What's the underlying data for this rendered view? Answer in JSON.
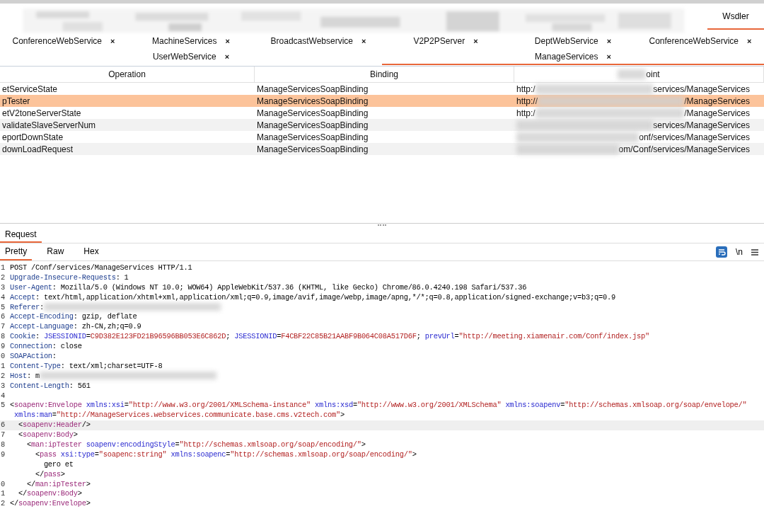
{
  "top_tabs": [
    {
      "label": "Wsdler",
      "selected": true
    }
  ],
  "service_tabs": [
    [
      {
        "label": "ConferenceWebService",
        "selected": false
      },
      {
        "label": "MachineServices",
        "selected": false
      },
      {
        "label": "BroadcastWebservice",
        "selected": false
      },
      {
        "label": "V2P2PServer",
        "selected": false
      },
      {
        "label": "DeptWebService",
        "selected": false
      },
      {
        "label": "ConferenceWebService",
        "selected": false
      }
    ],
    [
      {
        "label": "UserWebService",
        "selected": false
      },
      {
        "label": "ManageServices",
        "selected": true
      }
    ]
  ],
  "close_glyph": "×",
  "table": {
    "columns": [
      "Operation",
      "Binding",
      "oint"
    ],
    "rows": [
      {
        "operation": "etServiceState",
        "binding": "ManageServicesSoapBinding",
        "endpoint_start": "http:/",
        "endpoint_end": "services/ManageServices",
        "selected": false
      },
      {
        "operation": "pTester",
        "binding": "ManageServicesSoapBinding",
        "endpoint_start": "http://",
        "endpoint_end": "/ManageServices",
        "selected": true
      },
      {
        "operation": "etV2toneServerState",
        "binding": "ManageServicesSoapBinding",
        "endpoint_start": "http:/",
        "endpoint_end": "/ManageServices",
        "selected": false
      },
      {
        "operation": "validateSlaveServerNum",
        "binding": "ManageServicesSoapBinding",
        "endpoint_end": "services/ManageServices",
        "selected": false
      },
      {
        "operation": "eportDownState",
        "binding": "ManageServicesSoapBinding",
        "endpoint_end": "onf/services/ManageServices",
        "selected": false
      },
      {
        "operation": "downLoadRequest",
        "binding": "ManageServicesSoapBinding",
        "endpoint_end": "om/Conf/services/ManageServices",
        "selected": false
      }
    ]
  },
  "request_tab": {
    "label": "Request",
    "selected": true
  },
  "view_tabs": [
    {
      "label": "Pretty",
      "selected": true
    },
    {
      "label": "Raw",
      "selected": false
    },
    {
      "label": "Hex",
      "selected": false
    }
  ],
  "newline_toggle": "\\n",
  "lines": [
    {
      "no": "1",
      "segs": [
        {
          "kind": "plain",
          "text": "POST /Conf/services/ManageServices HTTP/1.1"
        }
      ]
    },
    {
      "no": "2",
      "segs": [
        {
          "kind": "key",
          "text": "Upgrade-Insecure-Requests"
        },
        {
          "kind": "plain",
          "text": ": 1"
        }
      ]
    },
    {
      "no": "3",
      "segs": [
        {
          "kind": "key",
          "text": "User-Agent"
        },
        {
          "kind": "plain",
          "text": ": Mozilla/5.0 (Windows NT 10.0; WOW64) AppleWebKit/537.36 (KHTML, like Gecko) Chrome/86.0.4240.198 Safari/537.36"
        }
      ]
    },
    {
      "no": "4",
      "segs": [
        {
          "kind": "key",
          "text": "Accept"
        },
        {
          "kind": "plain",
          "text": ": text/html,application/xhtml+xml,application/xml;q=0.9,image/avif,image/webp,image/apng,*/*;q=0.8,application/signed-exchange;v=b3;q=0.9"
        }
      ]
    },
    {
      "no": "5",
      "redacted": true,
      "segs": [
        {
          "kind": "key",
          "text": "Referer"
        },
        {
          "kind": "plain",
          "text": ":"
        }
      ]
    },
    {
      "no": "6",
      "segs": [
        {
          "kind": "key",
          "text": "Accept-Encoding"
        },
        {
          "kind": "plain",
          "text": ": gzip, deflate"
        }
      ]
    },
    {
      "no": "7",
      "segs": [
        {
          "kind": "key",
          "text": "Accept-Language"
        },
        {
          "kind": "plain",
          "text": ": zh-CN,zh;q=0.9"
        }
      ]
    },
    {
      "no": "8",
      "segs": [
        {
          "kind": "key",
          "text": "Cookie"
        },
        {
          "kind": "plain",
          "text": ": "
        },
        {
          "kind": "name",
          "text": "JSESSIONID"
        },
        {
          "kind": "plain",
          "text": "="
        },
        {
          "kind": "val",
          "text": "C9D382E123FD21B96596BB053E6C862D"
        },
        {
          "kind": "plain",
          "text": "; "
        },
        {
          "kind": "name",
          "text": "JSESSIONID"
        },
        {
          "kind": "plain",
          "text": "="
        },
        {
          "kind": "val",
          "text": "F4CBF22C85B21AABF9B064C08A517D6F"
        },
        {
          "kind": "plain",
          "text": "; "
        },
        {
          "kind": "name",
          "text": "prevUrl"
        },
        {
          "kind": "plain",
          "text": "="
        },
        {
          "kind": "val",
          "text": "\"http://meeting.xiamenair.com/Conf/index.jsp\""
        }
      ]
    },
    {
      "no": "9",
      "segs": [
        {
          "kind": "key",
          "text": "Connection"
        },
        {
          "kind": "plain",
          "text": ": close"
        }
      ]
    },
    {
      "no": "0",
      "segs": [
        {
          "kind": "key",
          "text": "SOAPAction"
        },
        {
          "kind": "plain",
          "text": ":"
        }
      ]
    },
    {
      "no": "1",
      "segs": [
        {
          "kind": "key",
          "text": "Content-Type"
        },
        {
          "kind": "plain",
          "text": ": text/xml;charset=UTF-8"
        }
      ]
    },
    {
      "no": "2",
      "redacted": true,
      "segs": [
        {
          "kind": "key",
          "text": "Host"
        },
        {
          "kind": "plain",
          "text": ": m"
        }
      ]
    },
    {
      "no": "3",
      "segs": [
        {
          "kind": "key",
          "text": "Content-Length"
        },
        {
          "kind": "plain",
          "text": ": 561"
        }
      ]
    },
    {
      "no": "4"
    },
    {
      "no": "5",
      "segs": [
        {
          "kind": "plain",
          "text": "<"
        },
        {
          "kind": "tag",
          "text": "soapenv:Envelope"
        },
        {
          "kind": "name",
          "text": " xmlns:xsi"
        },
        {
          "kind": "plain",
          "text": "="
        },
        {
          "kind": "val",
          "text": "\"http://www.w3.org/2001/XMLSchema-instance\""
        },
        {
          "kind": "name",
          "text": " xmlns:xsd"
        },
        {
          "kind": "plain",
          "text": "="
        },
        {
          "kind": "val",
          "text": "\"http://www.w3.org/2001/XMLSchema\""
        },
        {
          "kind": "name",
          "text": " xmlns:soapenv"
        },
        {
          "kind": "plain",
          "text": "="
        },
        {
          "kind": "val",
          "text": "\"http://schemas.xmlsoap.org/soap/envelope/\""
        }
      ]
    },
    {
      "segs": [
        {
          "kind": "name",
          "text": " xmlns:man"
        },
        {
          "kind": "plain",
          "text": "="
        },
        {
          "kind": "val",
          "text": "\"http://ManageServices.webservices.communicate.base.cms.v2tech.com\""
        },
        {
          "kind": "plain",
          "text": ">"
        }
      ]
    },
    {
      "no": "6",
      "highlighted": true,
      "segs": [
        {
          "kind": "plain",
          "text": "  <"
        },
        {
          "kind": "tag",
          "text": "soapenv:Header"
        },
        {
          "kind": "plain",
          "text": "/>"
        }
      ]
    },
    {
      "no": "7",
      "segs": [
        {
          "kind": "plain",
          "text": "  <"
        },
        {
          "kind": "tag",
          "text": "soapenv:Body"
        },
        {
          "kind": "plain",
          "text": ">"
        }
      ]
    },
    {
      "no": "8",
      "segs": [
        {
          "kind": "plain",
          "text": "    <"
        },
        {
          "kind": "tag",
          "text": "man:ipTester"
        },
        {
          "kind": "name",
          "text": " soapenv:encodingStyle"
        },
        {
          "kind": "plain",
          "text": "="
        },
        {
          "kind": "val",
          "text": "\"http://schemas.xmlsoap.org/soap/encoding/\""
        },
        {
          "kind": "plain",
          "text": ">"
        }
      ]
    },
    {
      "no": "9",
      "segs": [
        {
          "kind": "plain",
          "text": "      <"
        },
        {
          "kind": "tag",
          "text": "pass"
        },
        {
          "kind": "name",
          "text": " xsi:type"
        },
        {
          "kind": "plain",
          "text": "="
        },
        {
          "kind": "val",
          "text": "\"soapenc:string\""
        },
        {
          "kind": "name",
          "text": " xmlns:soapenc"
        },
        {
          "kind": "plain",
          "text": "="
        },
        {
          "kind": "val",
          "text": "\"http://schemas.xmlsoap.org/soap/encoding/\""
        },
        {
          "kind": "plain",
          "text": ">"
        }
      ]
    },
    {
      "segs": [
        {
          "kind": "plain",
          "text": "        gero et"
        }
      ]
    },
    {
      "segs": [
        {
          "kind": "plain",
          "text": "      </"
        },
        {
          "kind": "tag",
          "text": "pass"
        },
        {
          "kind": "plain",
          "text": ">"
        }
      ]
    },
    {
      "no": "0",
      "segs": [
        {
          "kind": "plain",
          "text": "    </"
        },
        {
          "kind": "tag",
          "text": "man:ipTester"
        },
        {
          "kind": "plain",
          "text": ">"
        }
      ]
    },
    {
      "no": "1",
      "segs": [
        {
          "kind": "plain",
          "text": "  </"
        },
        {
          "kind": "tag",
          "text": "soapenv:Body"
        },
        {
          "kind": "plain",
          "text": ">"
        }
      ]
    },
    {
      "no": "2",
      "segs": [
        {
          "kind": "plain",
          "text": "</"
        },
        {
          "kind": "tag",
          "text": "soapenv:Envelope"
        },
        {
          "kind": "plain",
          "text": ">"
        }
      ]
    }
  ]
}
